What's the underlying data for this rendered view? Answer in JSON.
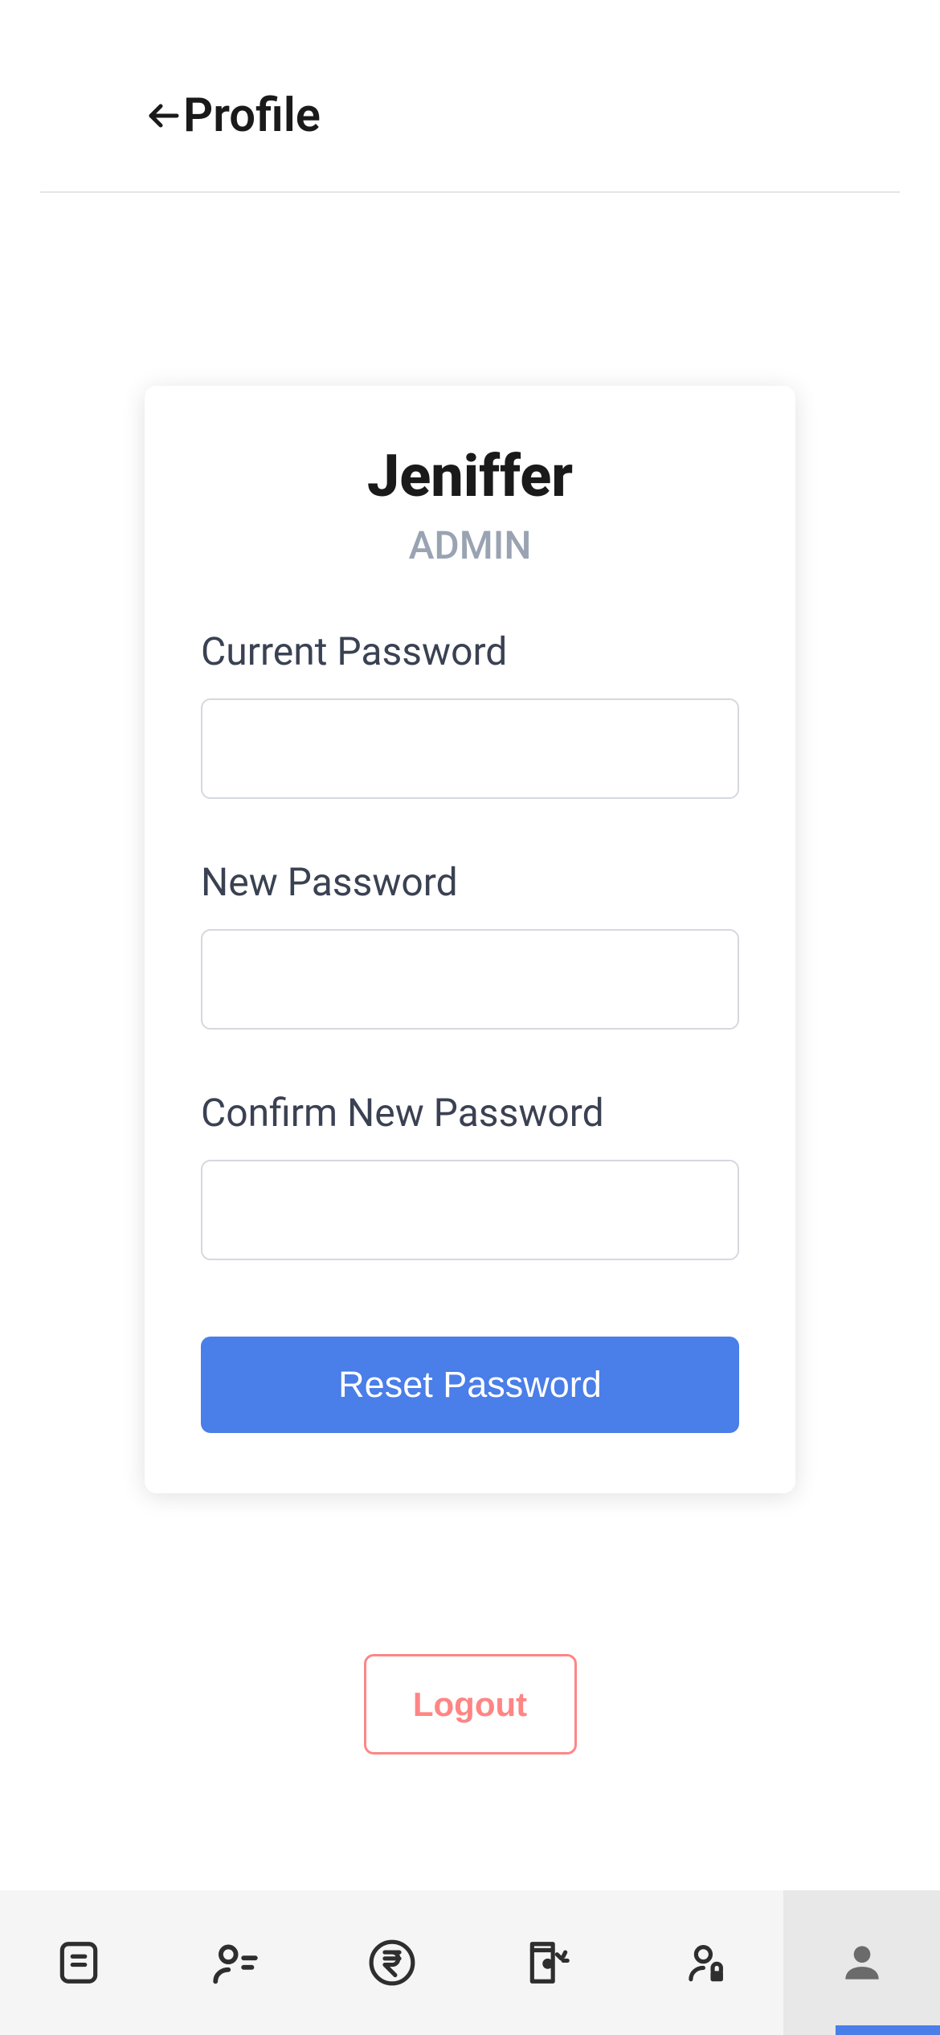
{
  "header": {
    "title": "Profile"
  },
  "profile": {
    "name": "Jeniffer",
    "role": "ADMIN"
  },
  "form": {
    "current_password_label": "Current Password",
    "current_password_value": "",
    "new_password_label": "New Password",
    "new_password_value": "",
    "confirm_password_label": "Confirm New Password",
    "confirm_password_value": "",
    "reset_button_label": "Reset Password"
  },
  "logout_label": "Logout",
  "nav": {
    "active_index": 5
  }
}
